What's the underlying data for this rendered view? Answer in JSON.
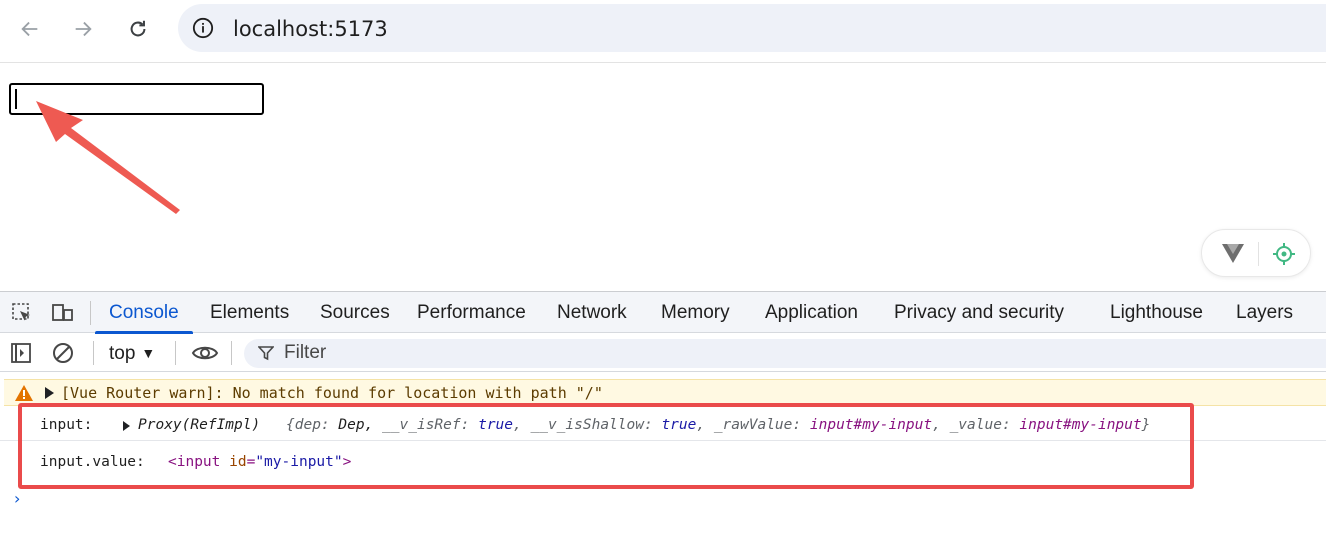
{
  "browser": {
    "back_icon": "arrow-left-icon",
    "forward_icon": "arrow-right-icon",
    "reload_icon": "reload-icon",
    "site_info_icon": "info-icon",
    "url": "localhost:5173"
  },
  "page": {
    "input_value": "",
    "annotation": "red-arrow"
  },
  "vue_devtools": {
    "logo_icon": "vue-logo-icon",
    "inspect_icon": "crosshair-icon",
    "accent": "#41b883"
  },
  "devtools": {
    "tabs": [
      {
        "label": "Console",
        "active": true
      },
      {
        "label": "Elements"
      },
      {
        "label": "Sources"
      },
      {
        "label": "Performance"
      },
      {
        "label": "Network"
      },
      {
        "label": "Memory"
      },
      {
        "label": "Application"
      },
      {
        "label": "Privacy and security"
      },
      {
        "label": "Lighthouse"
      },
      {
        "label": "Layers"
      }
    ],
    "toolbar": {
      "context": "top",
      "filter_placeholder": "Filter"
    },
    "warning": {
      "text": "[Vue Router warn]: No match found for location with path \"/\"",
      "color": "#fff9e2"
    },
    "logs": [
      {
        "label": "input:",
        "type": "Proxy(RefImpl)",
        "preview_open": "{",
        "k1": "dep:",
        "v1": "Dep,",
        "k2": "__v_isRef:",
        "v2": "true",
        "k3": "__v_isShallow:",
        "v3": "true",
        "k4": "_rawValue:",
        "v4": "input#my-input",
        "k5": "_value:",
        "v5": "input#my-input",
        "preview_close": "}"
      },
      {
        "label": "input.value:",
        "tag_open": "<input",
        "attr_name": "id",
        "attr_value": "\"my-input\"",
        "tag_close": ">"
      }
    ],
    "prompt": "›",
    "highlight_color": "#ea4b4b"
  }
}
